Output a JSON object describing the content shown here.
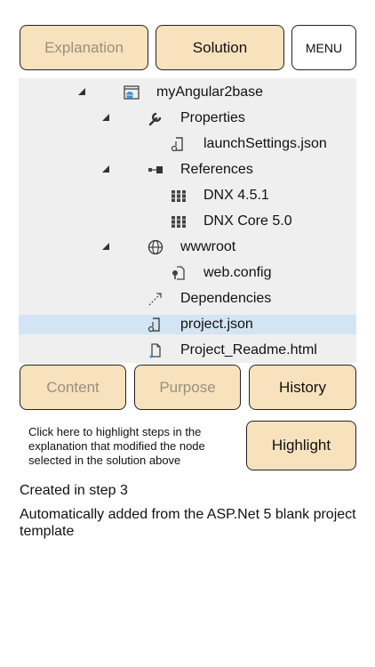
{
  "top_buttons": {
    "explanation": "Explanation",
    "solution": "Solution",
    "menu": "MENU"
  },
  "tree": {
    "items": [
      {
        "label": "myAngular2base",
        "icon": "web-project-icon",
        "expanded": true
      },
      {
        "label": "Properties",
        "icon": "wrench-icon",
        "expanded": true
      },
      {
        "label": "launchSettings.json",
        "icon": "json-file-icon"
      },
      {
        "label": "References",
        "icon": "references-icon",
        "expanded": true
      },
      {
        "label": "DNX 4.5.1",
        "icon": "library-icon"
      },
      {
        "label": "DNX Core 5.0",
        "icon": "library-icon"
      },
      {
        "label": "wwwroot",
        "icon": "globe-icon",
        "expanded": true
      },
      {
        "label": "web.config",
        "icon": "config-file-icon"
      },
      {
        "label": "Dependencies",
        "icon": "dependencies-icon"
      },
      {
        "label": "project.json",
        "icon": "json-file-icon",
        "selected": true
      },
      {
        "label": "Project_Readme.html",
        "icon": "html-file-icon"
      }
    ]
  },
  "bottom_buttons": {
    "content": "Content",
    "purpose": "Purpose",
    "history": "History",
    "highlight": "Highlight"
  },
  "highlight_hint": "Click here to highlight steps in the explanation that modified the node selected in the solution above",
  "created_text": "Created in step 3",
  "description_text": "Automatically added from the ASP.Net 5 blank project template",
  "colors": {
    "button_fill": "#f7e2bd",
    "tree_background": "#efefef",
    "selected_row": "#d3e4f5"
  }
}
